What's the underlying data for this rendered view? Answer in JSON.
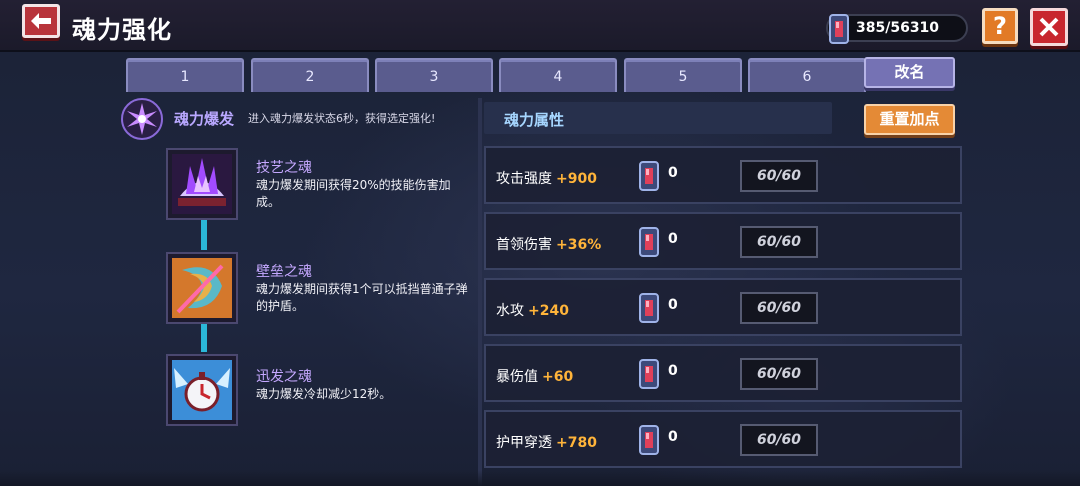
{
  "header": {
    "title": "魂力强化",
    "currency": {
      "icon": "soul-gem-icon",
      "value": "385/56310"
    },
    "help_label": "?"
  },
  "tabs": [
    "1",
    "2",
    "3",
    "4",
    "5",
    "6"
  ],
  "rename_label": "改名",
  "burst": {
    "icon": "soul-burst-icon",
    "title": "魂力爆发",
    "description": "进入魂力爆发状态6秒，获得选定强化!"
  },
  "souls": [
    {
      "icon": "skill-soul-icon",
      "name": "技艺之魂",
      "description": "魂力爆发期间获得20%的技能伤害加成。"
    },
    {
      "icon": "barrier-soul-icon",
      "name": "壁垒之魂",
      "description": "魂力爆发期间获得1个可以抵挡普通子弹的护盾。"
    },
    {
      "icon": "swift-soul-icon",
      "name": "迅发之魂",
      "description": "魂力爆发冷却减少12秒。"
    }
  ],
  "attributes": {
    "header": "魂力属性",
    "reset_label": "重置加点",
    "rows": [
      {
        "name": "攻击强度",
        "bonus": "+900",
        "count": "0",
        "level": "60/60"
      },
      {
        "name": "首领伤害",
        "bonus": "+36%",
        "count": "0",
        "level": "60/60"
      },
      {
        "name": "水攻",
        "bonus": "+240",
        "count": "0",
        "level": "60/60"
      },
      {
        "name": "暴伤值",
        "bonus": "+60",
        "count": "0",
        "level": "60/60"
      },
      {
        "name": "护甲穿透",
        "bonus": "+780",
        "count": "0",
        "level": "60/60"
      }
    ]
  },
  "colors": {
    "accent_orange": "#e48a36",
    "close_red": "#c8262e",
    "tab_purple": "#5a5c8e",
    "bonus_orange": "#ffb43a",
    "connector_cyan": "#2bb7d8"
  }
}
